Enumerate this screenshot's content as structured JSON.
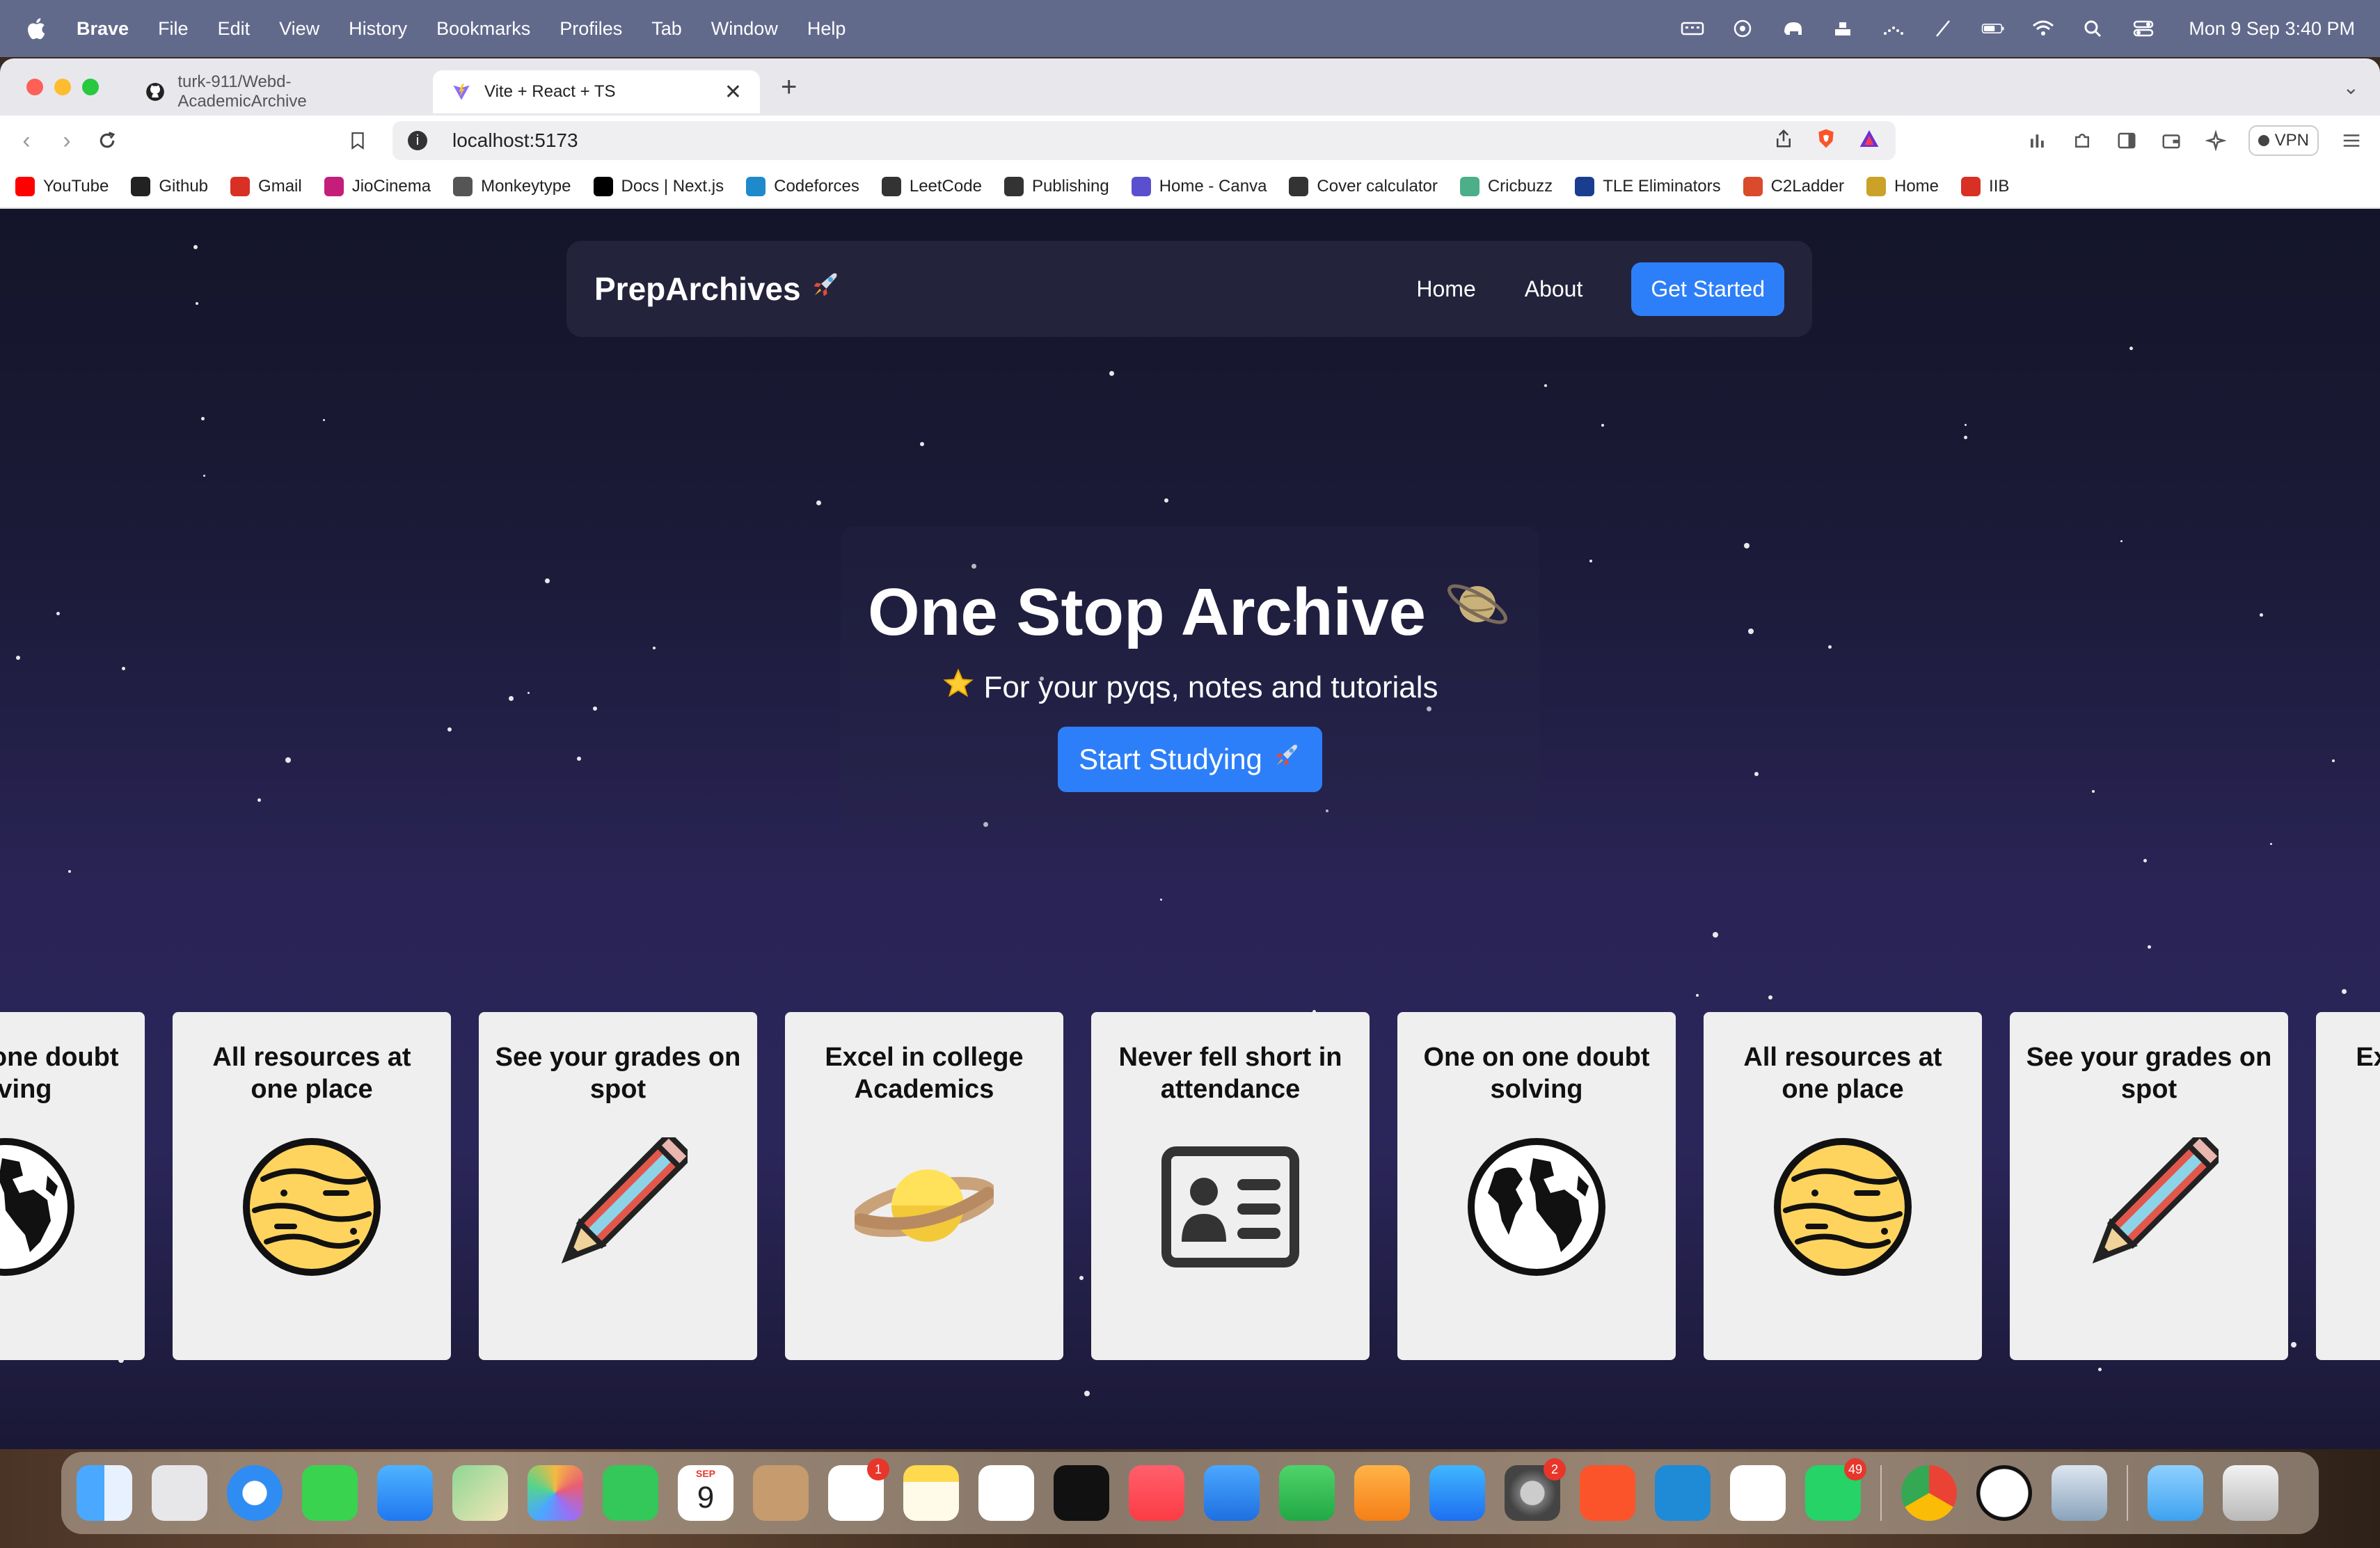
{
  "menubar": {
    "app_name": "Brave",
    "items": [
      "File",
      "Edit",
      "View",
      "History",
      "Bookmarks",
      "Profiles",
      "Tab",
      "Window",
      "Help"
    ],
    "clock": "Mon 9 Sep  3:40 PM"
  },
  "tabs": [
    {
      "title": "turk-911/Webd-AcademicArchive",
      "icon": "github-icon"
    },
    {
      "title": "Vite + React + TS",
      "icon": "vite-icon",
      "active": true
    }
  ],
  "toolbar": {
    "url": "localhost:5173",
    "vpn_label": "VPN"
  },
  "bookmarks": [
    {
      "label": "YouTube",
      "icon": "youtube-icon",
      "color": "#ff0000"
    },
    {
      "label": "Github",
      "icon": "github-icon",
      "color": "#222222"
    },
    {
      "label": "Gmail",
      "icon": "gmail-icon",
      "color": "#d93025"
    },
    {
      "label": "JioCinema",
      "icon": "jiocinema-icon",
      "color": "#c41e7a"
    },
    {
      "label": "Monkeytype",
      "icon": "monkeytype-icon",
      "color": "#555555"
    },
    {
      "label": "Docs | Next.js",
      "icon": "nextjs-icon",
      "color": "#000000"
    },
    {
      "label": "Codeforces",
      "icon": "codeforces-icon",
      "color": "#1f8acb"
    },
    {
      "label": "LeetCode",
      "icon": "leetcode-icon",
      "color": "#333333"
    },
    {
      "label": "Publishing",
      "icon": "publishing-icon",
      "color": "#333333"
    },
    {
      "label": "Home - Canva",
      "icon": "canva-icon",
      "color": "#5a4fcf"
    },
    {
      "label": "Cover calculator",
      "icon": "calculator-icon",
      "color": "#333333"
    },
    {
      "label": "Cricbuzz",
      "icon": "cricbuzz-icon",
      "color": "#4caf8a"
    },
    {
      "label": "TLE Eliminators",
      "icon": "tle-icon",
      "color": "#1a3d8f"
    },
    {
      "label": "C2Ladder",
      "icon": "c2ladder-icon",
      "color": "#d94b2b"
    },
    {
      "label": "Home",
      "icon": "home-icon",
      "color": "#c9a227"
    },
    {
      "label": "IIB",
      "icon": "gmail-icon",
      "color": "#d93025"
    }
  ],
  "site": {
    "brand": "PrepArchives",
    "nav": {
      "home": "Home",
      "about": "About",
      "cta": "Get Started"
    },
    "hero": {
      "title": "One Stop Archive",
      "subtitle": "For your pyqs, notes and tutorials",
      "button": "Start Studying"
    },
    "cards": [
      {
        "title": "One on one doubt solving",
        "icon": "globe-icon"
      },
      {
        "title": "All resources at one place",
        "icon": "planet-icon"
      },
      {
        "title": "See your grades on spot",
        "icon": "pencil-icon"
      },
      {
        "title": "Excel in college Academics",
        "icon": "saturn-icon"
      },
      {
        "title": "Never fell short in attendance",
        "icon": "id-card-icon"
      },
      {
        "title": "One on one doubt solving",
        "icon": "globe-icon"
      },
      {
        "title": "All resources at one place",
        "icon": "planet-icon"
      },
      {
        "title": "See your grades on spot",
        "icon": "pencil-icon"
      },
      {
        "title": "Excel in college Academics",
        "icon": "saturn-icon"
      }
    ],
    "accent_color": "#2d7ff9"
  },
  "dock": {
    "apps": [
      "Finder",
      "Launchpad",
      "Safari",
      "Messages",
      "Mail",
      "Maps",
      "Photos",
      "FaceTime",
      "Calendar",
      "Contacts",
      "Reminders",
      "Notes",
      "Freeform",
      "TV",
      "Music",
      "Keynote",
      "Numbers",
      "Pages",
      "App Store",
      "System Settings",
      "Brave",
      "VS Code",
      "ChatGPT",
      "WhatsApp",
      "Chrome",
      "Clock",
      "Preview",
      "Folder",
      "Trash"
    ],
    "calendar_month": "SEP",
    "calendar_day": "9",
    "badges": {
      "reminders": "1",
      "settings": "2",
      "whatsapp": "49"
    }
  }
}
